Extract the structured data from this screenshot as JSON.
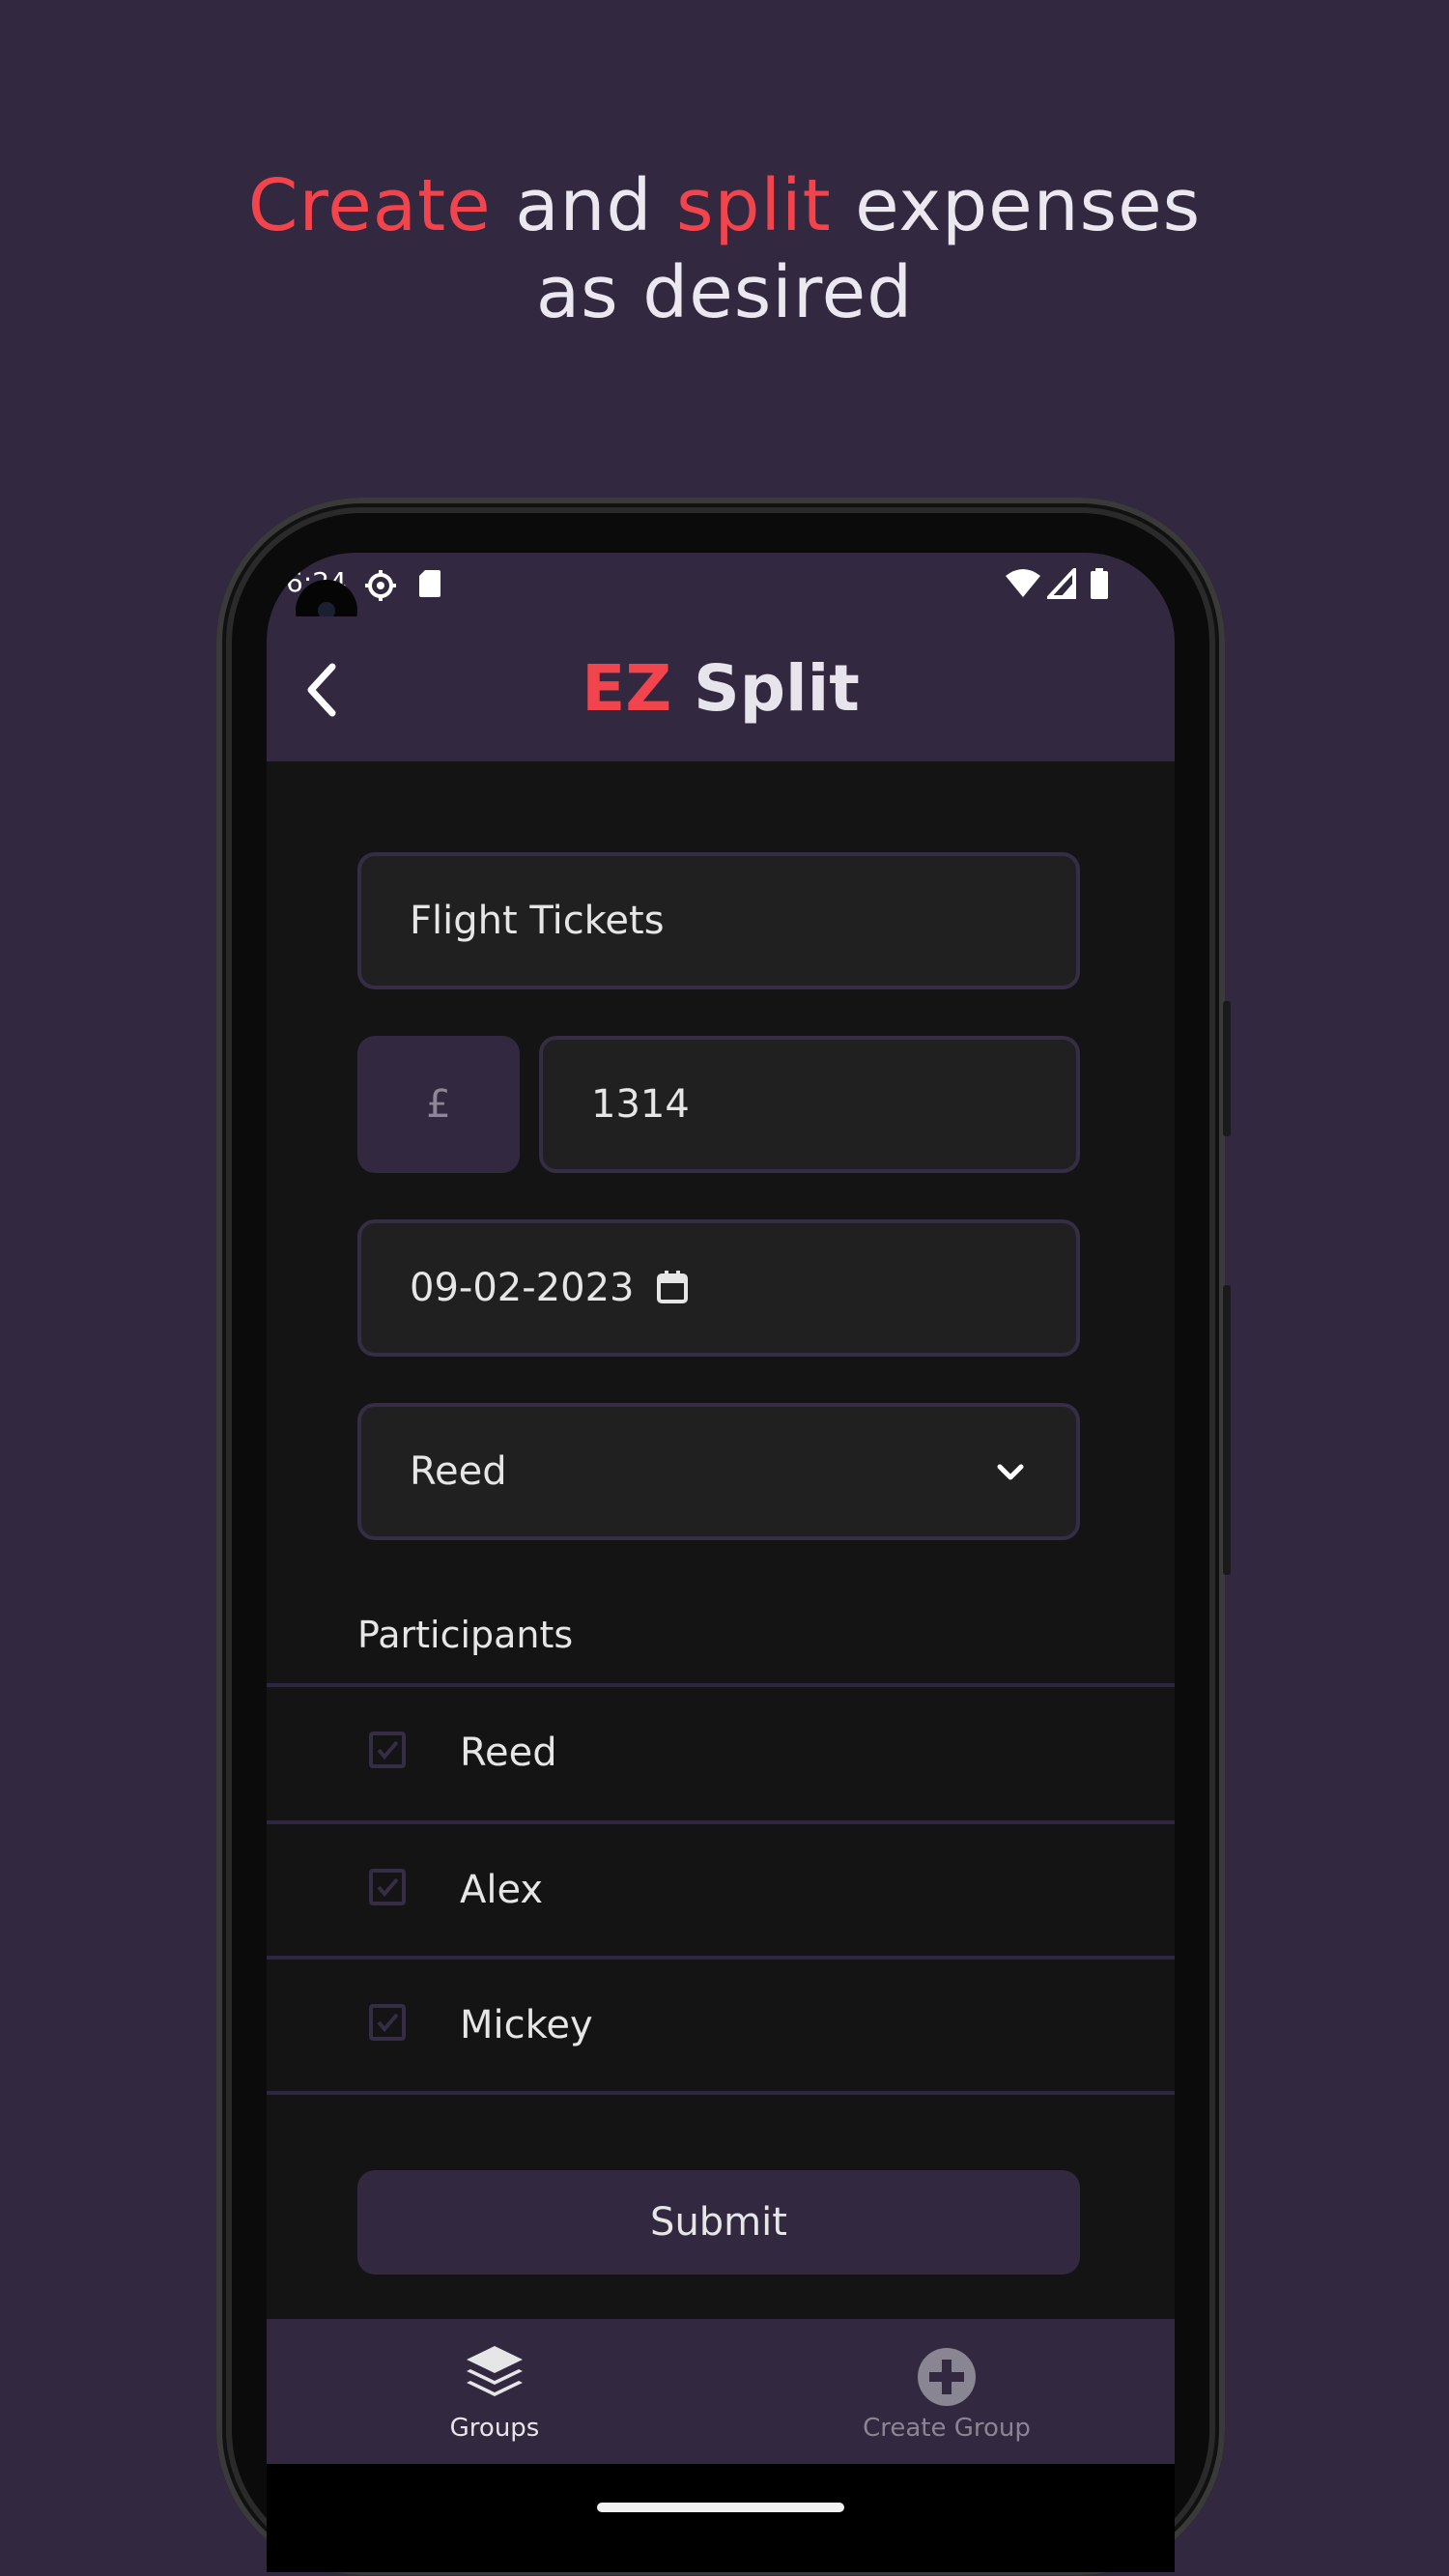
{
  "promo": {
    "word1": "Create",
    "word2": " and ",
    "word3": "split",
    "word4": " expenses",
    "line2": "as desired"
  },
  "status_bar": {
    "time": "6:24",
    "icons": [
      "settings-gear-icon",
      "sd-card-icon",
      "wifi-icon",
      "cell-signal-icon",
      "battery-icon"
    ]
  },
  "app_bar": {
    "title_accent": "EZ",
    "title_rest": " Split",
    "back_icon": "chevron-left-icon"
  },
  "form": {
    "expense_name": "Flight Tickets",
    "currency_symbol": "£",
    "amount": "1314",
    "date": "09-02-2023",
    "payer_selected": "Reed",
    "participants_label": "Participants",
    "participants": [
      {
        "name": "Reed",
        "checked": true
      },
      {
        "name": "Alex",
        "checked": true
      },
      {
        "name": "Mickey",
        "checked": true
      }
    ],
    "submit_label": "Submit"
  },
  "bottom_nav": {
    "items": [
      {
        "label": "Groups",
        "icon": "layers-icon",
        "active": true
      },
      {
        "label": "Create Group",
        "icon": "plus-circle-icon",
        "active": false
      }
    ]
  },
  "colors": {
    "background": "#322840",
    "accent": "#f2444c",
    "surface": "#141414",
    "field": "#202020"
  }
}
